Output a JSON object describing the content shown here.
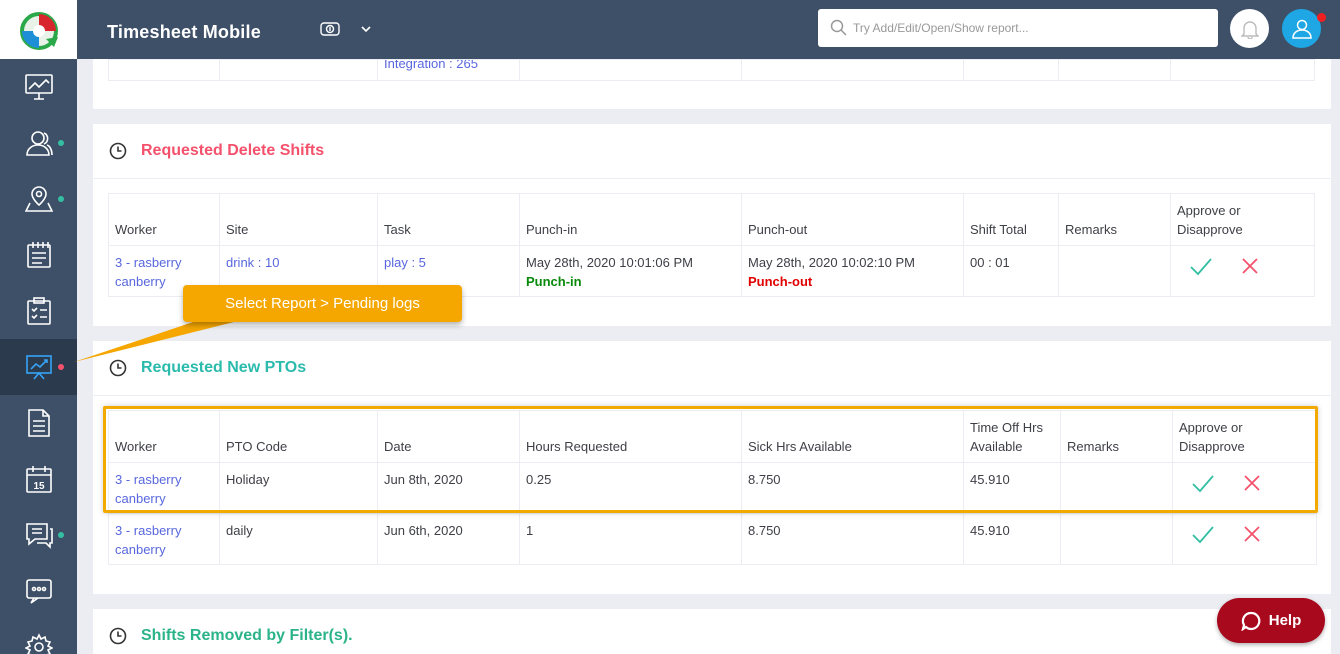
{
  "app": {
    "title": "Timesheet Mobile"
  },
  "search": {
    "placeholder": "Try Add/Edit/Open/Show report..."
  },
  "colors": {
    "sidebar": "#3e5068",
    "accent_red": "#f4516c",
    "accent_teal": "#34bfa3",
    "accent_cyan": "#36a3f7",
    "callout": "#f5a700",
    "help": "#a8091c"
  },
  "sidebar": {
    "items": [
      {
        "icon": "dashboard-icon",
        "dot": false
      },
      {
        "icon": "users-icon",
        "dot": true
      },
      {
        "icon": "map-icon",
        "dot": true
      },
      {
        "icon": "notes-icon",
        "dot": false
      },
      {
        "icon": "clipboard-icon",
        "dot": false
      },
      {
        "icon": "reports-icon",
        "dot": true
      },
      {
        "icon": "document-icon",
        "dot": false
      },
      {
        "icon": "calendar-icon",
        "dot": false,
        "day": "15"
      },
      {
        "icon": "chat-icon",
        "dot": true
      },
      {
        "icon": "messages-icon",
        "dot": false
      },
      {
        "icon": "settings-icon",
        "dot": false
      }
    ]
  },
  "top_partial": {
    "cell_text": "Integration : 265"
  },
  "delete_shifts": {
    "title": "Requested Delete Shifts",
    "headers": [
      "Worker",
      "Site",
      "Task",
      "Punch-in",
      "Punch-out",
      "Shift Total",
      "Remarks",
      "Approve or Disapprove"
    ],
    "rows": [
      {
        "worker": "3 - rasberry canberry",
        "site": "drink : 10",
        "task": "play : 5",
        "punch_in": "May 28th, 2020 10:01:06 PM",
        "punch_in_label": "Punch-in",
        "punch_out": "May 28th, 2020 10:02:10 PM",
        "punch_out_label": "Punch-out",
        "total": "00 : 01",
        "remarks": ""
      }
    ]
  },
  "callout": {
    "text": "Select Report > Pending logs"
  },
  "new_ptos": {
    "title": "Requested New PTOs",
    "headers": [
      "Worker",
      "PTO Code",
      "Date",
      "Hours Requested",
      "Sick Hrs Available",
      "Time Off Hrs Available",
      "Remarks",
      "Approve or Disapprove"
    ],
    "rows": [
      {
        "worker": "3 - rasberry canberry",
        "code": "Holiday",
        "date": "Jun 8th, 2020",
        "hours": "0.25",
        "sick": "8.750",
        "timeoff": "45.910",
        "remarks": ""
      },
      {
        "worker": "3 - rasberry canberry",
        "code": "daily",
        "date": "Jun 6th, 2020",
        "hours": "1",
        "sick": "8.750",
        "timeoff": "45.910",
        "remarks": ""
      }
    ]
  },
  "removed": {
    "title": "Shifts Removed by Filter(s)."
  },
  "help": {
    "label": "Help"
  }
}
